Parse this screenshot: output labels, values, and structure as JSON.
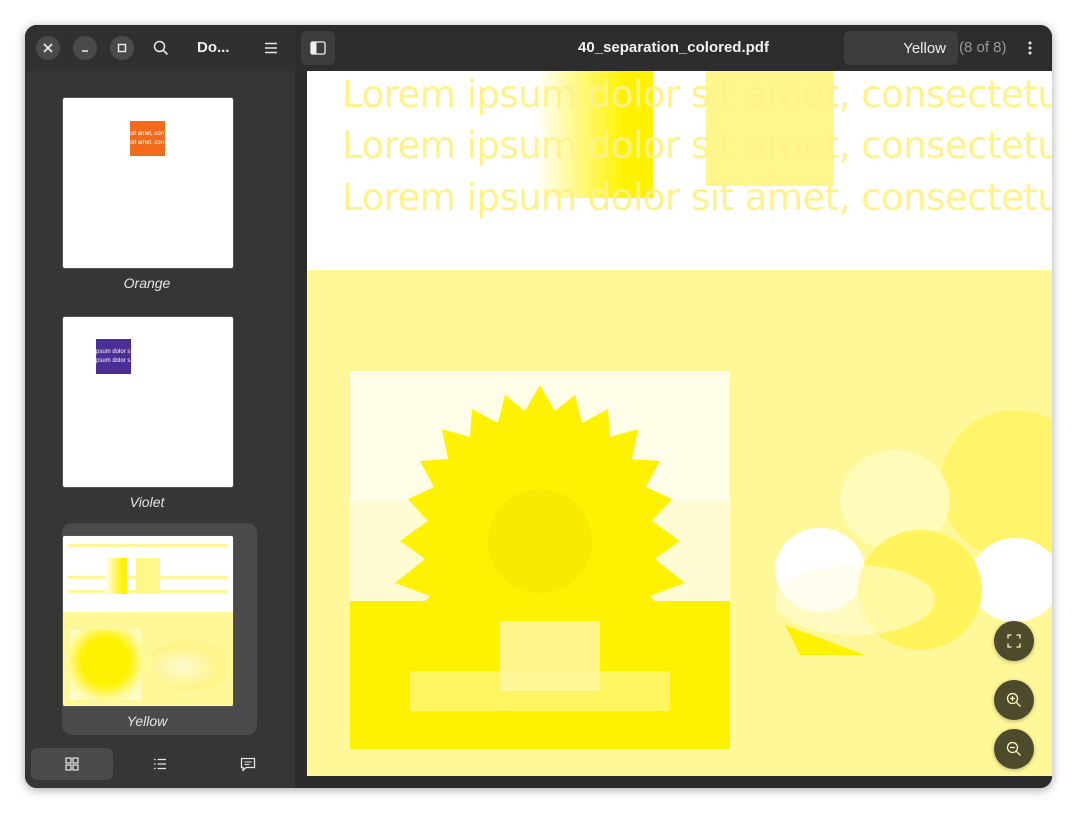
{
  "sidebar": {
    "title": "Do...",
    "thumbnails": [
      {
        "label": "Orange",
        "swatch_color": "#f26b1d",
        "swatch_text": "sit amet, con"
      },
      {
        "label": "Violet",
        "swatch_color": "#4b2e96",
        "swatch_text": "psum dolor s"
      },
      {
        "label": "Yellow",
        "selected": true
      }
    ]
  },
  "header": {
    "doc_title": "40_separation_colored.pdf",
    "separation_selected": "Yellow",
    "page_count": "(8 of 8)"
  },
  "page": {
    "lorem_lines": [
      "Lorem ipsum dolor sit amet, consectetuer ad",
      "Lorem ipsum dolor sit amet, consectetuer ad",
      "Lorem ipsum dolor sit amet, consectetuer ad"
    ]
  },
  "colors": {
    "accent_yellow": "#fff200",
    "light_yellow": "#fff899",
    "fab_bg": "#4e4a2c"
  }
}
